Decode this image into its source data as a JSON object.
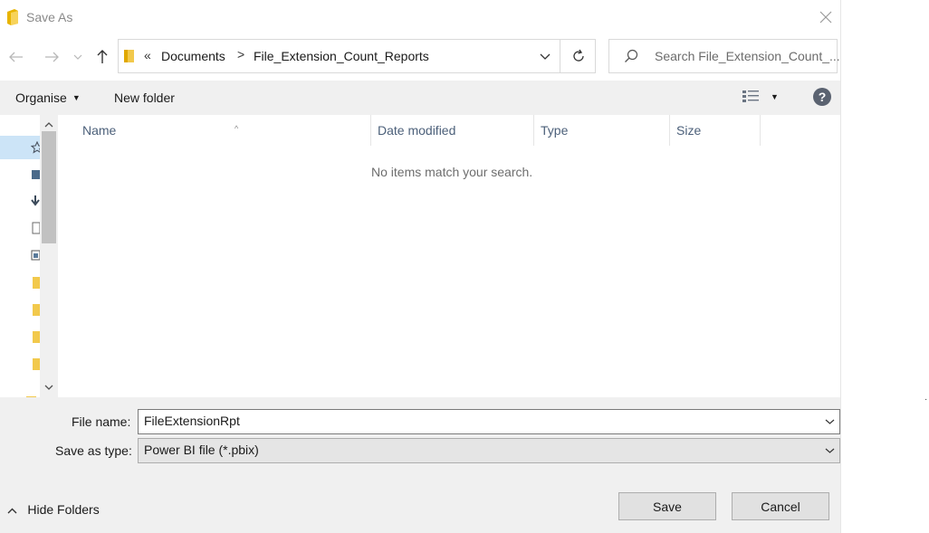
{
  "window": {
    "title": "Save As"
  },
  "address": {
    "overflow_chevron": "«",
    "segments": [
      "Documents",
      "File_Extension_Count_Reports"
    ],
    "separator": ">"
  },
  "search": {
    "placeholder": "Search File_Extension_Count_..."
  },
  "commands": {
    "organise": "Organise",
    "new_folder": "New folder"
  },
  "columns": [
    "Name",
    "Date modified",
    "Type",
    "Size"
  ],
  "list": {
    "empty_message": "No items match your search."
  },
  "form": {
    "file_name_label": "File name:",
    "file_name_value": "FileExtensionRpt",
    "type_label": "Save as type:",
    "type_value": "Power BI file (*.pbix)"
  },
  "footer": {
    "hide_folders": "Hide Folders",
    "save": "Save",
    "cancel": "Cancel"
  },
  "colors": {
    "accent_selection": "#cce4f7",
    "folder_yellow": "#f2c94c",
    "column_text": "#4c607a"
  },
  "icons": [
    "folder-icon",
    "back-arrow-icon",
    "forward-arrow-icon",
    "recent-chevron-icon",
    "up-arrow-icon",
    "chevron-down-icon",
    "refresh-icon",
    "search-icon",
    "view-options-icon",
    "help-icon",
    "close-icon",
    "quick-access-star-icon"
  ]
}
